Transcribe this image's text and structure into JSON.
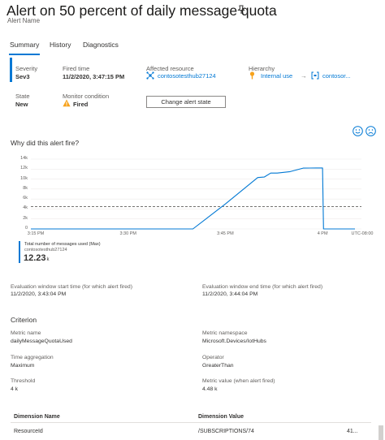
{
  "header": {
    "title": "Alert on 50 percent of daily message quota",
    "subtitle": "Alert Name"
  },
  "tabs": [
    {
      "label": "Summary",
      "active": true
    },
    {
      "label": "History",
      "active": false
    },
    {
      "label": "Diagnostics",
      "active": false
    }
  ],
  "essentials": {
    "severity_label": "Severity",
    "severity_value": "Sev3",
    "fired_time_label": "Fired time",
    "fired_time_value": "11/2/2020, 3:47:15 PM",
    "affected_label": "Affected resource",
    "affected_value": "contosotesthub27124",
    "hierarchy_label": "Hierarchy",
    "hierarchy_item1": "Internal use",
    "hierarchy_separator": "→",
    "hierarchy_item2": "contosor...",
    "state_label": "State",
    "state_value": "New",
    "monitor_label": "Monitor condition",
    "monitor_value": "Fired",
    "change_button": "Change alert state"
  },
  "feedback": {
    "happy": "smile-icon",
    "sad": "frown-icon"
  },
  "why_title": "Why did this alert fire?",
  "chart_data": {
    "type": "line",
    "yticks": [
      "14k",
      "12k",
      "10k",
      "8k",
      "6k",
      "4k",
      "2k",
      "0"
    ],
    "xticks": [
      "3:15 PM",
      "3:30 PM",
      "3:45 PM",
      "4 PM"
    ],
    "timezone": "UTC-08:00",
    "ylim": [
      0,
      14000
    ],
    "x_minutes_from": "3:15 PM",
    "x": [
      "3:15 PM",
      "3:20 PM",
      "3:25 PM",
      "3:30 PM",
      "3:35 PM",
      "3:40 PM",
      "3:45 PM",
      "3:50 PM",
      "3:51 PM",
      "3:52 PM",
      "3:53 PM",
      "3:55 PM",
      "3:57 PM",
      "3:59 PM",
      "4:00 PM",
      "4:00 PM",
      "4:01 PM",
      "4:05 PM"
    ],
    "values": [
      0,
      0,
      0,
      0,
      0,
      0,
      5000,
      10300,
      10400,
      11200,
      11200,
      11500,
      12200,
      12230,
      12230,
      0,
      0,
      0
    ],
    "threshold": 4480,
    "series": [
      {
        "name": "Total number of messages used (Max)",
        "resource": "contosotesthub27124"
      }
    ],
    "line_color": "#0078d4",
    "threshold_color": "#605e5c"
  },
  "legend": {
    "name": "Total number of messages used (Max)",
    "resource": "contosotesthub27124",
    "value": "12.23",
    "unit": "k"
  },
  "evaluation": {
    "start_label": "Evaluation window start time (for which alert fired)",
    "start_value": "11/2/2020, 3:43:04 PM",
    "end_label": "Evaluation window end time (for which alert fired)",
    "end_value": "11/2/2020, 3:44:04 PM"
  },
  "criterion": {
    "title": "Criterion",
    "metric_name_label": "Metric name",
    "metric_name_value": "dailyMessageQuotaUsed",
    "metric_namespace_label": "Metric namespace",
    "metric_namespace_value": "Microsoft.Devices/IotHubs",
    "time_agg_label": "Time aggregation",
    "time_agg_value": "Maximum",
    "operator_label": "Operator",
    "operator_value": "GreaterThan",
    "threshold_label": "Threshold",
    "threshold_value": "4 k",
    "metric_value_label": "Metric value (when alert fired)",
    "metric_value_value": "4.48 k"
  },
  "dimensions": {
    "name_header": "Dimension Name",
    "value_header": "Dimension Value",
    "rows": [
      {
        "name": "ResourceId",
        "value": "/SUBSCRIPTIONS/74",
        "extra": "41..."
      }
    ]
  },
  "colors": {
    "accent": "#0078d4",
    "warning": "#f7a21b"
  }
}
